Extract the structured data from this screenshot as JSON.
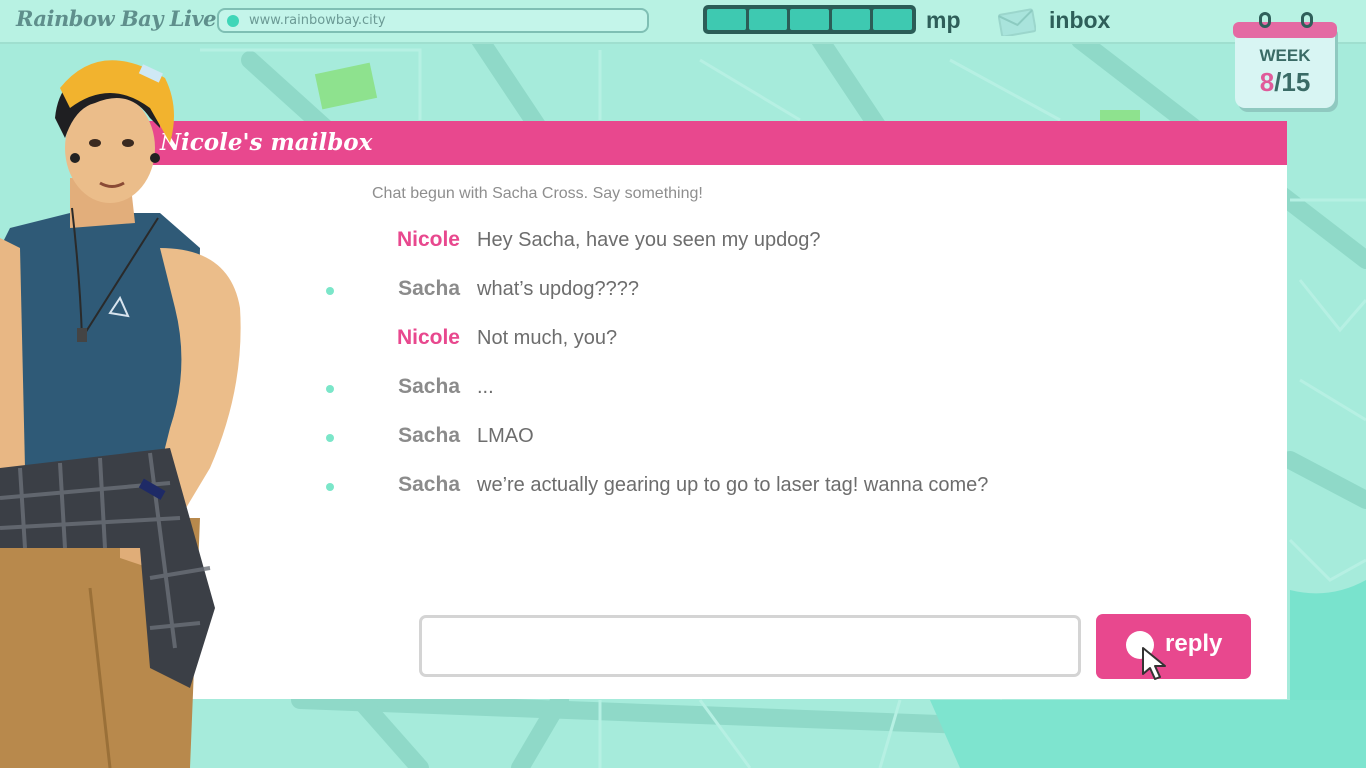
{
  "app": {
    "title": "Rainbow Bay Live"
  },
  "browser": {
    "url": "www.rainbowbay.city"
  },
  "status": {
    "mp_label": "mp",
    "mp_segments_filled": 5,
    "mp_segments_total": 5,
    "inbox_label": "inbox"
  },
  "calendar": {
    "label": "WEEK",
    "current_week": "8",
    "total_weeks": "/15"
  },
  "mailbox": {
    "title": "Nicole's mailbox",
    "intro": "Chat begun with Sacha Cross. Say something!",
    "messages": [
      {
        "sender": "Nicole",
        "text": "Hey Sacha, have you seen my updog?",
        "from_self": true
      },
      {
        "sender": "Sacha",
        "text": "what’s updog????",
        "from_self": false
      },
      {
        "sender": "Nicole",
        "text": "Not much, you?",
        "from_self": true
      },
      {
        "sender": "Sacha",
        "text": "...",
        "from_self": false
      },
      {
        "sender": "Sacha",
        "text": "LMAO",
        "from_self": false
      },
      {
        "sender": "Sacha",
        "text": "we’re actually gearing up to go to laser tag! wanna come?",
        "from_self": false
      }
    ],
    "reply_input_value": "",
    "reply_button_label": "reply"
  },
  "colors": {
    "accent_pink": "#e8488e",
    "teal": "#3ec9b1",
    "topbar_bg": "#b8f2e3",
    "map_bg": "#a8ebdc"
  },
  "icons": {
    "url_status": "status-dot-icon",
    "inbox": "envelope-icon",
    "calendar": "calendar-icon",
    "reply": "circle-icon",
    "cursor": "mouse-pointer-icon"
  }
}
